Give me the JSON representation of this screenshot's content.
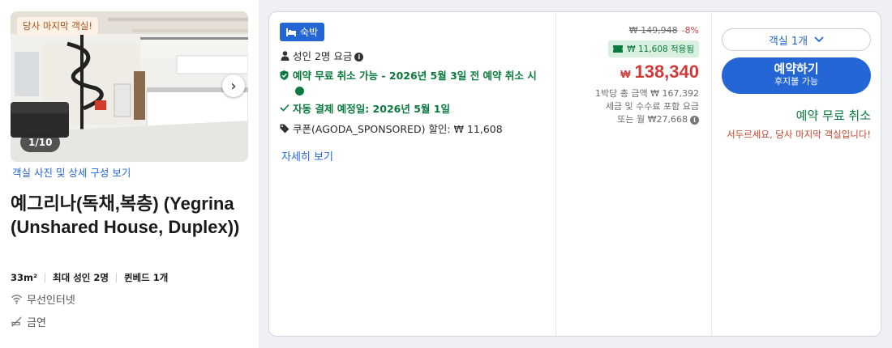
{
  "room": {
    "last_room_tag": "당사 마지막 객실!",
    "photo_counter": "1/10",
    "photo_link": "객실 사진 및 상세 구성 보기",
    "name": "예그리나(독채,복층) (Yegrina (Unshared House, Duplex))",
    "specs": [
      "33m²",
      "최대 성인 2명",
      "퀸베드 1개"
    ],
    "amenities": [
      {
        "icon": "wifi-icon",
        "label": "무선인터넷"
      },
      {
        "icon": "no-smoking-icon",
        "label": "금연"
      }
    ]
  },
  "offer": {
    "badge": "숙박",
    "conditions": {
      "guests": "성인 2명 요금",
      "free_cancel": "예약 무료 취소 가능 - 2026년 5월 3일 전 예약 취소 시",
      "autopay": "자동 결제 예정일: 2026년 5월 1일",
      "coupon": "쿠폰(AGODA_SPONSORED) 할인: ₩ 11,608"
    },
    "details_link": "자세히 보기"
  },
  "price": {
    "original": "₩ 149,948",
    "discount_pct": "-8%",
    "coupon_applied": "₩ 11,608 적용됨",
    "currency_symbol": "₩",
    "final": "138,340",
    "per_night_total": "1박당 총 금액 ₩ 167,392",
    "tax_note": "세금 및 수수료 포함 요금",
    "monthly": "또는 월 ₩27,668"
  },
  "booking": {
    "room_qty": "객실 1개",
    "book_label": "예약하기",
    "book_sublabel": "후지불 가능",
    "free_cancel": "예약 무료 취소",
    "hurry": "서두르세요, 당사 마지막 객실입니다!"
  },
  "colors": {
    "accent": "#2466d6",
    "price_red": "#d23a3a",
    "success_green": "#0b7a3e",
    "warning_orange": "#c0442a"
  }
}
